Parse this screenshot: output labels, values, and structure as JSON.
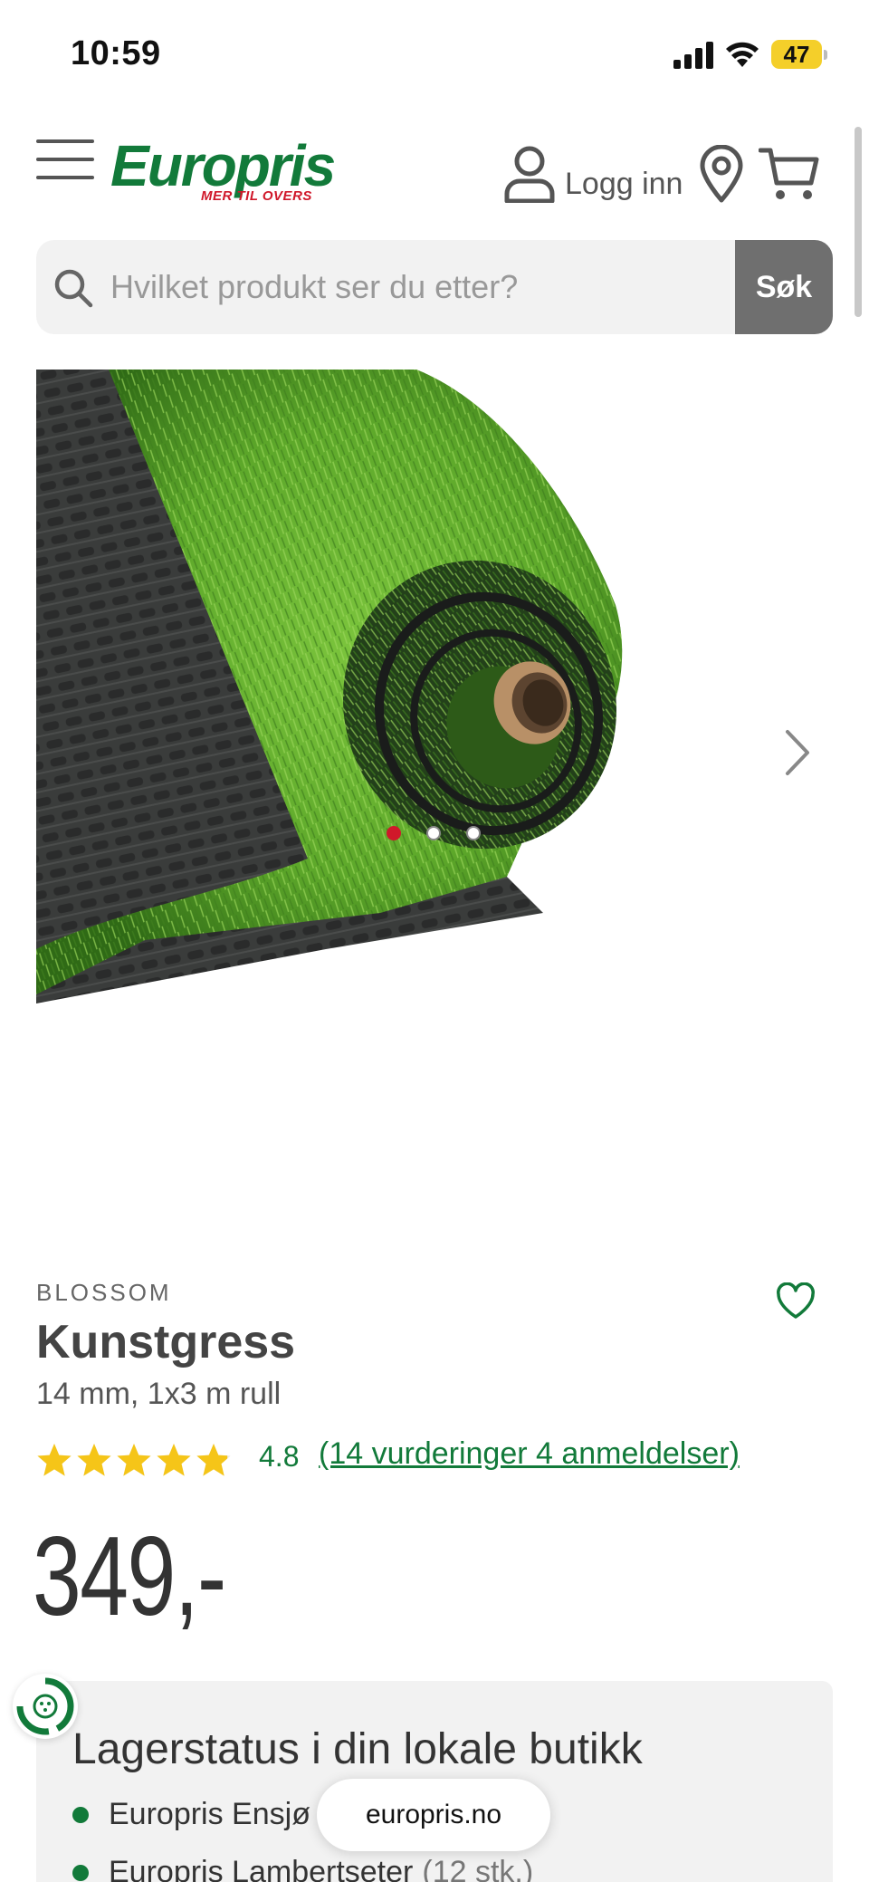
{
  "status_bar": {
    "time": "10:59",
    "battery": "47"
  },
  "header": {
    "logo_text": "Europris",
    "logo_tagline": "MER TIL OVERS",
    "login_label": "Logg inn"
  },
  "search": {
    "placeholder": "Hvilket produkt ser du etter?",
    "button_label": "Søk"
  },
  "gallery": {
    "image_count": 3,
    "active_index": 0
  },
  "product": {
    "brand": "BLOSSOM",
    "title": "Kunstgress",
    "subtitle": "14 mm, 1x3 m rull",
    "rating": "4.8",
    "rating_fraction": 0.96,
    "reviews_text": "(14 vurderinger 4 anmeldelser)",
    "price": "349,-"
  },
  "stock": {
    "title": "Lagerstatus i din lokale butikk",
    "stores": [
      {
        "name": "Europris Ensjø",
        "qty": "("
      },
      {
        "name": "Europris Lambertseter",
        "qty": "(12 stk.)"
      }
    ]
  },
  "browser": {
    "url": "europris.no"
  },
  "colors": {
    "brand_green": "#127a3a",
    "brand_red": "#d0182a",
    "star": "#f5c518"
  }
}
